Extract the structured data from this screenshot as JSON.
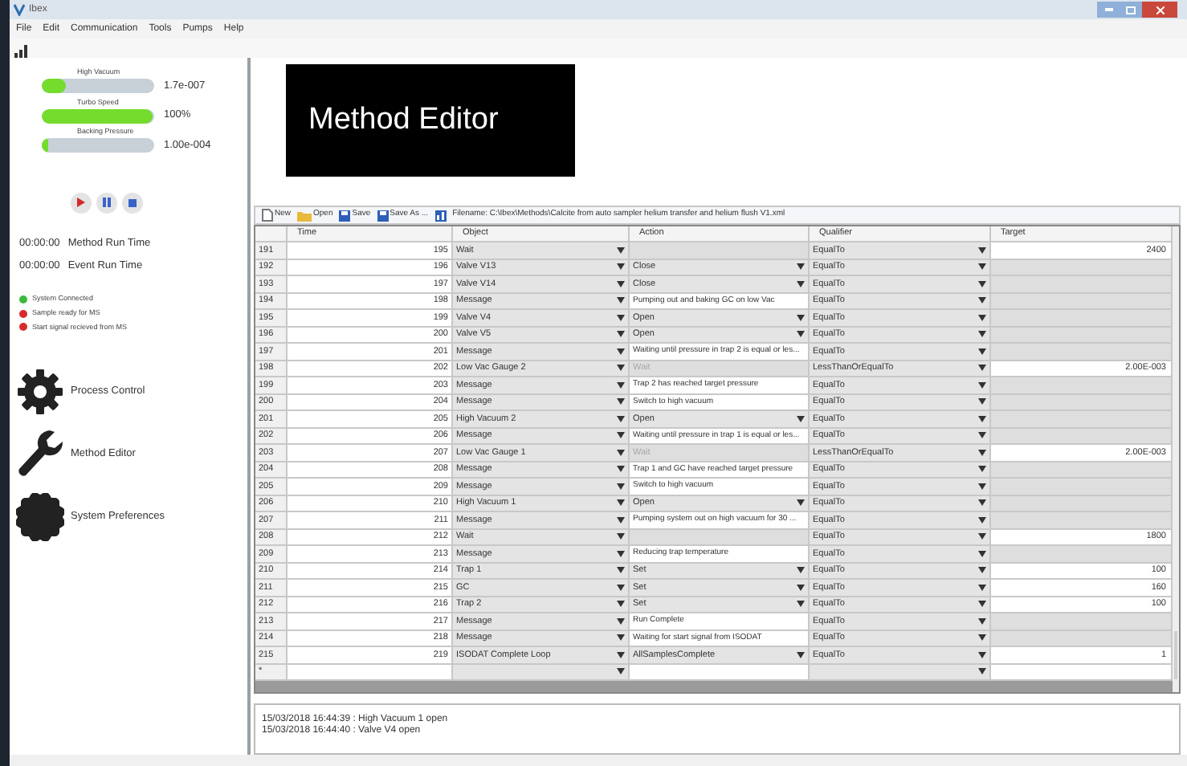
{
  "window": {
    "title": "Ibex"
  },
  "menu": [
    "File",
    "Edit",
    "Communication",
    "Tools",
    "Pumps",
    "Help"
  ],
  "gauges": [
    {
      "label": "High Vacuum",
      "level": 0.22,
      "reading": "1.7e-007"
    },
    {
      "label": "Turbo Speed",
      "level": 0.98,
      "reading": "100%"
    },
    {
      "label": "Backing Pressure",
      "level": 0.06,
      "reading": "1.00e-004"
    }
  ],
  "timers": [
    {
      "time": "00:00:00",
      "label": "Method Run Time"
    },
    {
      "time": "00:00:00",
      "label": "Event Run Time"
    }
  ],
  "statuses": [
    {
      "label": "System Connected",
      "color": "#3cb93c"
    },
    {
      "label": "Sample ready for MS",
      "color": "#d92b2b"
    },
    {
      "label": "Start signal recieved from MS",
      "color": "#d92b2b"
    }
  ],
  "nav": [
    {
      "label": "Process Control",
      "kind": "gear"
    },
    {
      "label": "Method Editor",
      "kind": "wrench"
    },
    {
      "label": "System Preferences",
      "kind": "seal"
    }
  ],
  "banner": "Method Editor",
  "toolbar": {
    "buttons": [
      {
        "label": "New",
        "kind": "new"
      },
      {
        "label": "Open",
        "kind": "open"
      },
      {
        "label": "Save",
        "kind": "save"
      },
      {
        "label": "Save As ...",
        "kind": "save"
      }
    ],
    "filename": "Filename: C:\\Ibex\\Methods\\Calcite from auto sampler helium transfer and helium flush V1.xml"
  },
  "table": {
    "columns": [
      "Time",
      "Object",
      "Action",
      "Qualifier",
      "Target"
    ],
    "rows": [
      {
        "kind": "step",
        "header": "191",
        "time": "195",
        "object": "Wait",
        "action": {
          "kind": "empty"
        },
        "qualifier": "EqualTo",
        "target": "2400"
      },
      {
        "kind": "step",
        "header": "192",
        "time": "196",
        "object": "Valve V13",
        "action": {
          "kind": "dropdown",
          "text": "Close"
        },
        "qualifier": "EqualTo"
      },
      {
        "kind": "step",
        "header": "193",
        "time": "197",
        "object": "Valve V14",
        "action": {
          "kind": "dropdown",
          "text": "Close"
        },
        "qualifier": "EqualTo"
      },
      {
        "kind": "step",
        "header": "194",
        "time": "198",
        "object": "Message",
        "action": {
          "kind": "text",
          "text": "Pumping out and baking GC on low Vac"
        },
        "qualifier": "EqualTo"
      },
      {
        "kind": "step",
        "header": "195",
        "time": "199",
        "object": "Valve V4",
        "action": {
          "kind": "dropdown",
          "text": "Open"
        },
        "qualifier": "EqualTo"
      },
      {
        "kind": "step",
        "header": "196",
        "time": "200",
        "object": "Valve V5",
        "action": {
          "kind": "dropdown",
          "text": "Open"
        },
        "qualifier": "EqualTo"
      },
      {
        "kind": "step",
        "header": "197",
        "time": "201",
        "object": "Message",
        "action": {
          "kind": "text",
          "text": "Waiting until pressure in trap 2 is equal or les..."
        },
        "qualifier": "EqualTo"
      },
      {
        "kind": "step",
        "header": "198",
        "time": "202",
        "object": "Low Vac Gauge 2",
        "action": {
          "kind": "disabled",
          "text": "Wait"
        },
        "qualifier": "LessThanOrEqualTo",
        "target": "2.00E-003"
      },
      {
        "kind": "step",
        "header": "199",
        "time": "203",
        "object": "Message",
        "action": {
          "kind": "text",
          "text": "Trap 2 has reached target pressure"
        },
        "qualifier": "EqualTo"
      },
      {
        "kind": "step",
        "header": "200",
        "time": "204",
        "object": "Message",
        "action": {
          "kind": "text",
          "text": "Switch to high vacuum"
        },
        "qualifier": "EqualTo"
      },
      {
        "kind": "step",
        "header": "201",
        "time": "205",
        "object": "High Vacuum 2",
        "action": {
          "kind": "dropdown",
          "text": "Open"
        },
        "qualifier": "EqualTo"
      },
      {
        "kind": "step",
        "header": "202",
        "time": "206",
        "object": "Message",
        "action": {
          "kind": "text",
          "text": "Waiting until pressure in trap 1 is equal or les..."
        },
        "qualifier": "EqualTo"
      },
      {
        "kind": "step",
        "header": "203",
        "time": "207",
        "object": "Low Vac Gauge 1",
        "action": {
          "kind": "disabled",
          "text": "Wait"
        },
        "qualifier": "LessThanOrEqualTo",
        "target": "2.00E-003"
      },
      {
        "kind": "step",
        "header": "204",
        "time": "208",
        "object": "Message",
        "action": {
          "kind": "text",
          "text": "Trap 1 and GC have reached target pressure"
        },
        "qualifier": "EqualTo"
      },
      {
        "kind": "step",
        "header": "205",
        "time": "209",
        "object": "Message",
        "action": {
          "kind": "text",
          "text": "Switch to high vacuum"
        },
        "qualifier": "EqualTo"
      },
      {
        "kind": "step",
        "header": "206",
        "time": "210",
        "object": "High Vacuum 1",
        "action": {
          "kind": "dropdown",
          "text": "Open"
        },
        "qualifier": "EqualTo"
      },
      {
        "kind": "step",
        "header": "207",
        "time": "211",
        "object": "Message",
        "action": {
          "kind": "text",
          "text": "Pumping system out on high vacuum for 30 ..."
        },
        "qualifier": "EqualTo"
      },
      {
        "kind": "step",
        "header": "208",
        "time": "212",
        "object": "Wait",
        "action": {
          "kind": "empty"
        },
        "qualifier": "EqualTo",
        "target": "1800"
      },
      {
        "kind": "step",
        "header": "209",
        "time": "213",
        "object": "Message",
        "action": {
          "kind": "text",
          "text": "Reducing trap temperature"
        },
        "qualifier": "EqualTo"
      },
      {
        "kind": "step",
        "header": "210",
        "time": "214",
        "object": "Trap 1",
        "action": {
          "kind": "dropdown",
          "text": "Set"
        },
        "qualifier": "EqualTo",
        "target": "100"
      },
      {
        "kind": "step",
        "header": "211",
        "time": "215",
        "object": "GC",
        "action": {
          "kind": "dropdown",
          "text": "Set"
        },
        "qualifier": "EqualTo",
        "target": "160"
      },
      {
        "kind": "step",
        "header": "212",
        "time": "216",
        "object": "Trap 2",
        "action": {
          "kind": "dropdown",
          "text": "Set"
        },
        "qualifier": "EqualTo",
        "target": "100"
      },
      {
        "kind": "step",
        "header": "213",
        "time": "217",
        "object": "Message",
        "action": {
          "kind": "text",
          "text": "Run Complete"
        },
        "qualifier": "EqualTo"
      },
      {
        "kind": "step",
        "header": "214",
        "time": "218",
        "object": "Message",
        "action": {
          "kind": "text",
          "text": "Waiting for start signal from ISODAT"
        },
        "qualifier": "EqualTo"
      },
      {
        "kind": "step",
        "header": "215",
        "time": "219",
        "object": "ISODAT Complete Loop",
        "action": {
          "kind": "dropdown",
          "text": "AllSamplesComplete"
        },
        "qualifier": "EqualTo",
        "target": "1"
      },
      {
        "kind": "new",
        "header": "*"
      }
    ]
  },
  "log": [
    "15/03/2018 16:44:39 : High Vacuum 1 open",
    "15/03/2018 16:44:40 : Valve V4 open"
  ]
}
